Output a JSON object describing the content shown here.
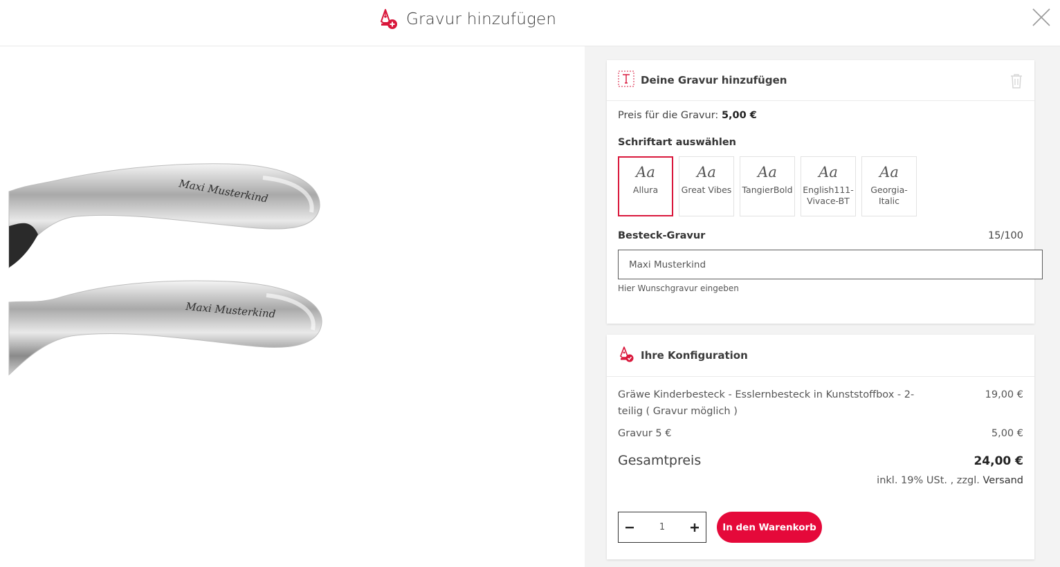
{
  "header": {
    "title": "Gravur hinzufügen"
  },
  "preview": {
    "engraving_text_1": "Maxi Musterkind",
    "engraving_text_2": "Maxi Musterkind"
  },
  "engraving": {
    "card_title": "Deine Gravur hinzufügen",
    "price_label": "Preis für die Gravur:",
    "price_value": "5,00 €",
    "font_section_label": "Schriftart auswählen",
    "fonts": [
      {
        "sample": "Aa",
        "name": "Allura",
        "selected": true
      },
      {
        "sample": "Aa",
        "name": "Great Vibes"
      },
      {
        "sample": "Aa",
        "name": "TangierBold"
      },
      {
        "sample": "Aa",
        "name": "English111-Vivace-BT"
      },
      {
        "sample": "Aa",
        "name": "Georgia-Italic"
      }
    ],
    "field_label": "Besteck-Gravur",
    "counter": "15/100",
    "input_value": "Maxi Musterkind",
    "hint": "Hier Wunschgravur eingeben"
  },
  "config": {
    "card_title": "Ihre Konfiguration",
    "rows": [
      {
        "label": "Gräwe Kinderbesteck - Esslernbesteck in Kunststoffbox - 2-teilig ( Gravur möglich )",
        "value": "19,00 €"
      },
      {
        "label": "Gravur 5 €",
        "value": "5,00 €"
      }
    ],
    "total_label": "Gesamtpreis",
    "total_value": "24,00 €",
    "tax_text": "inkl. 19% USt. , zzgl.",
    "shipping_link": "Versand",
    "quantity": "1",
    "cart_button": "In den Warenkorb"
  },
  "colors": {
    "accent": "#e5093a",
    "selected_border": "#d9173b",
    "panel_bg": "#f3f3f3"
  },
  "icons": [
    "pen-add-icon",
    "close-icon",
    "text-icon",
    "trash-icon",
    "pen-check-icon",
    "minus-icon",
    "plus-icon"
  ]
}
